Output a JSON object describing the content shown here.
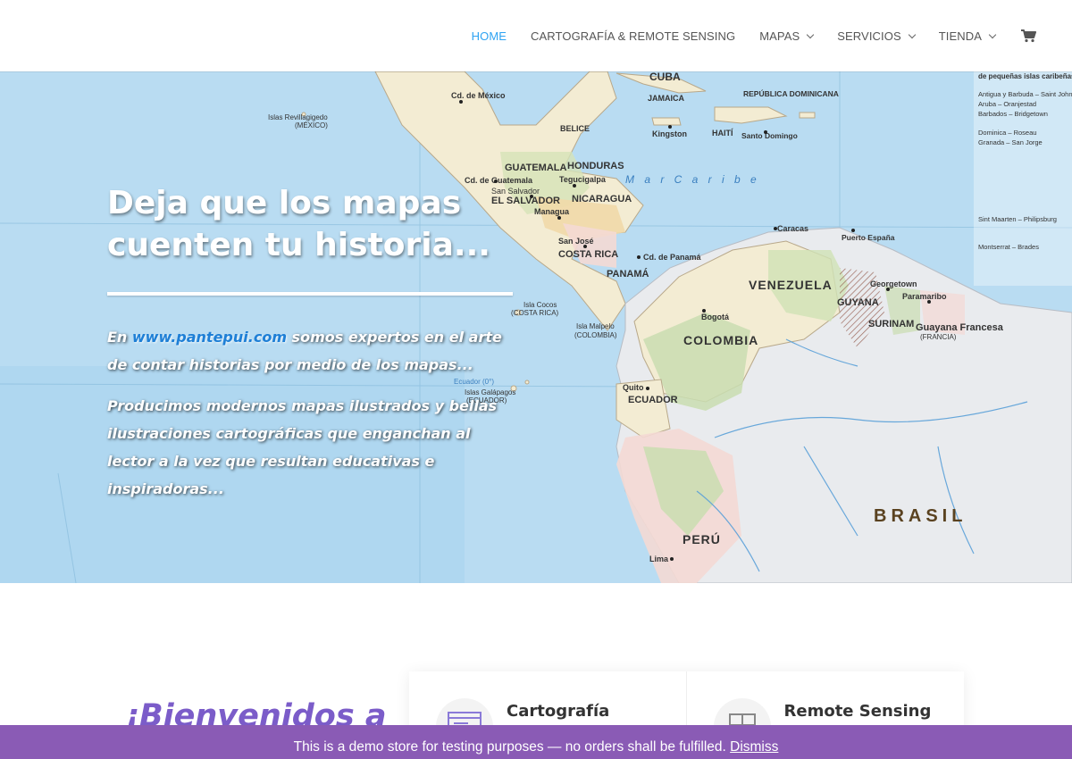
{
  "nav": {
    "items": [
      {
        "label": "HOME",
        "active": true,
        "has_dropdown": false
      },
      {
        "label": "CARTOGRAFÍA & REMOTE SENSING",
        "active": false,
        "has_dropdown": false
      },
      {
        "label": "MAPAS",
        "active": false,
        "has_dropdown": true
      },
      {
        "label": "SERVICIOS",
        "active": false,
        "has_dropdown": true
      },
      {
        "label": "TIENDA",
        "active": false,
        "has_dropdown": true
      }
    ],
    "cart_icon": "shopping-cart-icon",
    "active_color": "#2ea3f2"
  },
  "hero": {
    "title": "Deja que los mapas cuenten tu historia...",
    "intro_prefix": "En ",
    "intro_link": "www.pantepui.com",
    "intro_suffix": " somos expertos en el arte de contar historias por medio de los mapas...",
    "paragraph2": "Producimos modernos mapas ilustrados y bellas ilustraciones cartográficas que enganchan al lector a la vez que resultan educativas e inspiradoras...",
    "map_labels": {
      "sea": "M a r   C a r i b e",
      "countries": [
        "CUBA",
        "JAMAICA",
        "HAITÍ",
        "REPÚBLICA DOMINICANA",
        "BELICE",
        "HONDURAS",
        "GUATEMALA",
        "EL SALVADOR",
        "NICARAGUA",
        "COSTA RICA",
        "PANAMÁ",
        "VENEZUELA",
        "COLOMBIA",
        "GUYANA",
        "SURINAM",
        "ECUADOR",
        "PERÚ",
        "BRASIL"
      ],
      "regions": [
        "Guayana Francesa",
        "(FRANCIA)"
      ],
      "cities": [
        "Cd. de México",
        "Cd. de Guatemala",
        "San Salvador",
        "Tegucigalpa",
        "Managua",
        "San José",
        "Cd. de Panamá",
        "Bogotá",
        "Caracas",
        "Georgetown",
        "Paramaribo",
        "Quito",
        "Lima",
        "Kingston",
        "Santo Domingo",
        "Puerto España"
      ],
      "islands": [
        "Islas Revillagigedo",
        "(MÉXICO)",
        "Islas Galápagos",
        "(ECUADOR)",
        "Isla Cocos",
        "(COSTA RICA)",
        "Isla Malpelo",
        "(COLOMBIA)",
        "Ecuador (0°)",
        "de pequeñas islas caribeñas",
        "Antigua y Barbuda – Saint John",
        "Aruba – Oranjestad",
        "Barbados – Bridgetown",
        "Dominica – Roseau",
        "Granada – San Jorge",
        "Sint Maarten – Philipsburg",
        "Montserrat – Brades"
      ]
    },
    "colors": {
      "sea": "#b9dcf2",
      "land_light": "#f3ecd3",
      "land_green": "#c9ddb0",
      "brazil": "#e9ebee",
      "pink": "#f4d9d4"
    }
  },
  "welcome": {
    "heading": "¡Bienvenidos a"
  },
  "cards": [
    {
      "title": "Cartografía",
      "icon": "browser-window-icon"
    },
    {
      "title": "Remote Sensing",
      "icon": "grid-layout-icon"
    }
  ],
  "notice": {
    "text": "This is a demo store for testing purposes — no orders shall be fulfilled.",
    "dismiss": "Dismiss",
    "color": "#8a5bb5"
  }
}
